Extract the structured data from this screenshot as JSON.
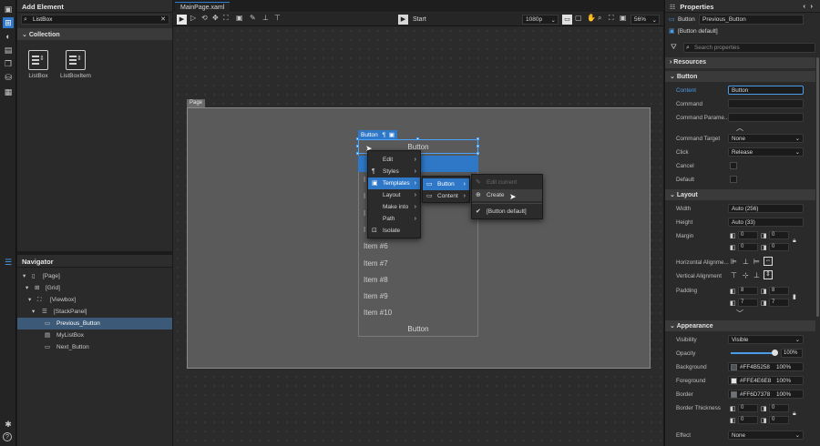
{
  "add_element": {
    "title": "Add Element",
    "search_value": "ListBox",
    "collection_label": "Collection",
    "tiles": [
      {
        "label": "ListBox"
      },
      {
        "label": "ListBoxItem"
      }
    ]
  },
  "navigator": {
    "title": "Navigator",
    "tree": [
      "[Page]",
      "[Grid]",
      "[Viewbox]",
      "[StackPanel]",
      "Previous_Button",
      "MyListBox",
      "Next_Button"
    ]
  },
  "document": {
    "tab": "MainPage.xaml",
    "start_label": "Start",
    "resolution": "1080p",
    "zoom": "56%"
  },
  "canvas": {
    "page_label": "Page",
    "selection_tag": "Button",
    "button_top": "Button",
    "button_bottom": "Button",
    "items": [
      "Item #6",
      "Item #7",
      "Item #8",
      "Item #9",
      "Item #10"
    ]
  },
  "context_menu": {
    "main": [
      "Edit",
      "Styles",
      "Templates",
      "Layout",
      "Make into",
      "Path",
      "Isolate"
    ],
    "templates_sub": [
      "Button",
      "Content"
    ],
    "button_sub": [
      "Edit current",
      "Create",
      "[Button default]"
    ]
  },
  "properties": {
    "title": "Properties",
    "type": "Button",
    "name": "Previous_Button",
    "template": "[Button default]",
    "search_placeholder": "Search properties",
    "sections": {
      "resources": "Resources",
      "button": "Button",
      "layout": "Layout",
      "appearance": "Appearance"
    },
    "button_props": {
      "content_label": "Content",
      "content_value": "Button",
      "command_label": "Command",
      "command_param_label": "Command Parame...",
      "command_target_label": "Command Target",
      "command_target_value": "None",
      "click_label": "Click",
      "click_value": "Release",
      "cancel_label": "Cancel",
      "default_label": "Default"
    },
    "layout_props": {
      "width_label": "Width",
      "width_value": "Auto (256)",
      "height_label": "Height",
      "height_value": "Auto (33)",
      "margin_label": "Margin",
      "margin_values": [
        "0",
        "0",
        "0",
        "0"
      ],
      "halign_label": "Horizontal Alignme...",
      "valign_label": "Vertical Alignment",
      "padding_label": "Padding",
      "padding_values": [
        "8",
        "8",
        "7",
        "7"
      ]
    },
    "appearance_props": {
      "visibility_label": "Visibility",
      "visibility_value": "Visible",
      "opacity_label": "Opacity",
      "opacity_value": "100%",
      "background_label": "Background",
      "background_value": "#FF4B5258",
      "background_pct": "100%",
      "foreground_label": "Foreground",
      "foreground_value": "#FFE4E6E8",
      "foreground_pct": "100%",
      "border_label": "Border",
      "border_value": "#FF6D7378",
      "border_pct": "100%",
      "border_thickness_label": "Border Thickness",
      "border_thickness_values": [
        "0",
        "0",
        "0",
        "0"
      ],
      "effect_label": "Effect",
      "effect_value": "None"
    },
    "colors": {
      "background": "#4B5258",
      "foreground": "#E4E6E8",
      "border": "#6D7378"
    }
  },
  "icons": [
    "add-element-icon",
    "navigator-icon",
    "search-icon",
    "close-icon",
    "play-icon",
    "bug-icon",
    "help-icon"
  ]
}
